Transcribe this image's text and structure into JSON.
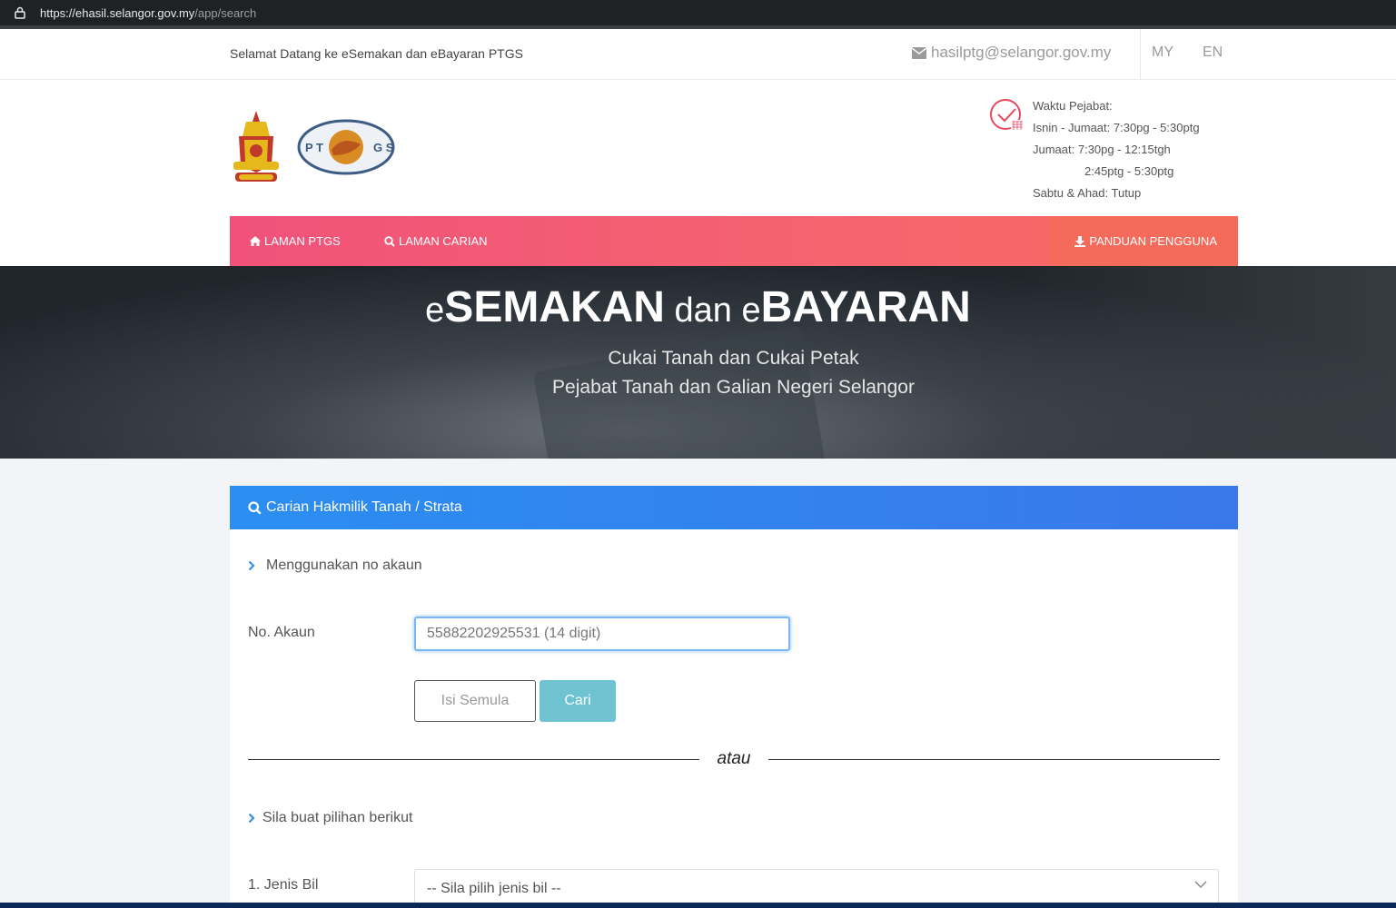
{
  "browser": {
    "url_host": "https://ehasil.selangor.gov.my",
    "url_path": "/app/search"
  },
  "topbar": {
    "welcome": "Selamat Datang ke eSemakan dan eBayaran PTGS",
    "email": "hasilptg@selangor.gov.my",
    "lang_my": "MY",
    "lang_en": "EN"
  },
  "header": {
    "ptgs_logo_text": "PTGS",
    "office_hours": {
      "title": "Waktu Pejabat:",
      "line1": "Isnin - Jumaat: 7:30pg - 5:30ptg",
      "line2": "Jumaat: 7:30pg - 12:15tgh",
      "line3": "2:45ptg - 5:30ptg",
      "line4": "Sabtu & Ahad: Tutup"
    }
  },
  "nav": {
    "home": "LAMAN PTGS",
    "search": "LAMAN CARIAN",
    "guide": "PANDUAN PENGGUNA"
  },
  "hero": {
    "title_e1": "e",
    "title_semakan": "SEMAKAN",
    "title_dan": " dan ",
    "title_e2": "e",
    "title_bayaran": "BAYARAN",
    "subtitle1": "Cukai Tanah dan Cukai Petak",
    "subtitle2": "Pejabat Tanah dan Galian Negeri Selangor"
  },
  "search_card": {
    "header": "Carian Hakmilik Tanah / Strata",
    "section1": "Menggunakan no akaun",
    "account_label": "No. Akaun",
    "account_placeholder": "55882202925531 (14 digit)",
    "reset_button": "Isi Semula",
    "search_button": "Cari",
    "divider_text": "atau",
    "section2": "Sila buat pilihan berikut",
    "bill_type_label": "1. Jenis Bil",
    "bill_type_value": "-- Sila pilih jenis bil --"
  },
  "colors": {
    "nav_gradient_start": "#f0527a",
    "nav_gradient_end": "#f76b62",
    "card_header": "#2b8ef0",
    "search_button": "#6fc2d0"
  }
}
